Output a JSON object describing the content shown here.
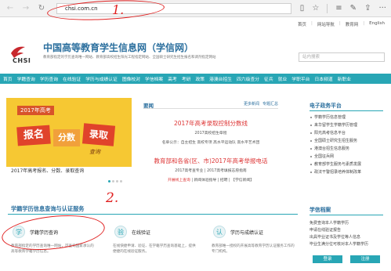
{
  "browser": {
    "back": "←",
    "forward": "→",
    "refresh": "↻",
    "url": "chsi.com.cn",
    "reading": "▯",
    "favorite": "☆",
    "hub": "≡",
    "notes": "✎",
    "share": "⇪",
    "more": "···"
  },
  "annotations": {
    "one": "1.",
    "two": "2."
  },
  "toplinks": [
    "首页",
    "网站导航",
    "教育网",
    "English"
  ],
  "header": {
    "logo_text": "CHSI",
    "title": "中国高等教育学生信息网（学信网）",
    "desc": "教育部指定的学历查询唯一网站、教育部高校招生阳光工程指定网站、全国硕士研究生招生报名和调剂指定网站",
    "search_placeholder": "站内搜索"
  },
  "nav": [
    "首页",
    "学籍查询",
    "学历查询",
    "在线验证",
    "学历与成绩认证",
    "图像校对",
    "学信档案",
    "高考",
    "考研",
    "政策",
    "港澳台招生",
    "港澳台招生",
    "四六级查分",
    "征兵",
    "就业",
    "学职平台",
    "日本频道",
    "新职业"
  ],
  "banner": {
    "tag": "2017年高考",
    "w1": "报名",
    "w2": "分数",
    "w3": "录取",
    "w4": "查询",
    "caption": "2017年高考报名、分数、录取查询"
  },
  "news": {
    "title": "要闻",
    "more": "更多新闻",
    "topics": "专题汇总",
    "headline1": "2017年高考录取控制分数线",
    "sub1": "2017高校招生章程",
    "sub2": "名单公示：自主招生  高校专项  高水平运动队  高水平艺术团",
    "headline2": "教育部和各省(区、市)2017年高考举报电话",
    "sub3": "2017高考查专业 | 2017高考填报志愿指南",
    "sub4_red": "开展线上查询",
    "sub4_rest": " | 新闻体验指导 | 招聘 | 【学信新闻】"
  },
  "eservice": {
    "title": "电子政务平台",
    "items": [
      "学籍学历信息管理",
      "来华留学生学籍学历管理",
      "阳光高考信息平台",
      "全国硕士研究生招生服务",
      "港澳台招生信息服务",
      "全国征兵网",
      "教育部学生服务与素质发展",
      "政法干警招录培养体制改革"
    ]
  },
  "section": {
    "title": "学籍学历信息查询与认证服务",
    "cards": [
      {
        "icon": "学",
        "title": "学籍学历查询",
        "desc": "教育部指定的学历查询唯一网站，可查询国家承认的高等教育学籍学历信息。"
      },
      {
        "icon": "验",
        "title": "在线验证",
        "desc": "在线快捷申请、验证、在学籍学历查询基础上，提供便捷的在线验证服务。"
      },
      {
        "icon": "认",
        "title": "学历与成绩认证",
        "desc": "教育部唯一授权的开展高等教育学历认证服务工作的专门机构。"
      }
    ]
  },
  "archive": {
    "title": "学信档案",
    "items": [
      "免费查询本人学籍学历",
      "申请在线验证报告",
      "出具毕业证书及学位等人信息",
      "毕业生满分位可核对本人学籍学历"
    ],
    "login": "登录",
    "register": "注册"
  }
}
